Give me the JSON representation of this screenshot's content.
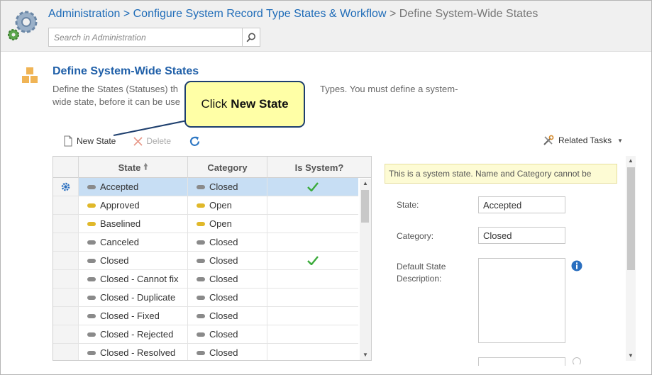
{
  "breadcrumb": {
    "items": [
      "Administration",
      "> Configure System Record Type States & Workflow"
    ],
    "current": "> Define System-Wide States"
  },
  "search": {
    "placeholder": "Search in Administration",
    "value": "",
    "icon": "search-icon"
  },
  "page": {
    "title": "Define System-Wide States",
    "description_start": "Define the States (Statuses) th",
    "description_mid": "Types. You must define a system-",
    "description_end": "wide state, before it can be use"
  },
  "callout": {
    "prefix": "Click",
    "bold": "New State"
  },
  "toolbar": {
    "new_label": "New State",
    "delete_label": "Delete",
    "refresh_icon": "refresh-icon",
    "related_label": "Related Tasks"
  },
  "grid": {
    "headers": {
      "state": "State",
      "category": "Category",
      "is_system": "Is System?"
    },
    "rows": [
      {
        "state": "Accepted",
        "category": "Closed",
        "system": true,
        "selected": true
      },
      {
        "state": "Approved",
        "category": "Open",
        "system": false
      },
      {
        "state": "Baselined",
        "category": "Open",
        "system": false
      },
      {
        "state": "Canceled",
        "category": "Closed",
        "system": false
      },
      {
        "state": "Closed",
        "category": "Closed",
        "system": true
      },
      {
        "state": "Closed - Cannot fix",
        "category": "Closed",
        "system": false
      },
      {
        "state": "Closed - Duplicate",
        "category": "Closed",
        "system": false
      },
      {
        "state": "Closed - Fixed",
        "category": "Closed",
        "system": false
      },
      {
        "state": "Closed - Rejected",
        "category": "Closed",
        "system": false
      },
      {
        "state": "Closed - Resolved",
        "category": "Closed",
        "system": false
      }
    ]
  },
  "detail": {
    "notice": "This is a system state. Name and Category cannot be",
    "state_label": "State:",
    "state_value": "Accepted",
    "category_label": "Category:",
    "category_value": "Closed",
    "desc_label_1": "Default State",
    "desc_label_2": "Description:",
    "desc_value": ""
  },
  "colors": {
    "link": "#1f6cb8",
    "title": "#1f5fa8",
    "selected_row": "#c7def4",
    "callout_bg": "#ffffa6",
    "open": "#e0b82a",
    "closed": "#8a8a8a"
  }
}
